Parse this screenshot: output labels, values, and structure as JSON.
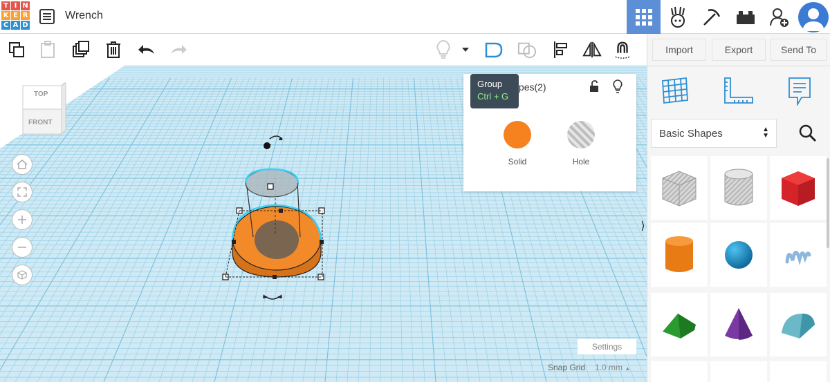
{
  "app": {
    "logo_letters": [
      "T",
      "I",
      "N",
      "K",
      "E",
      "R",
      "C",
      "A",
      "D"
    ],
    "logo_colors": [
      "#e2574c",
      "#e2574c",
      "#e2574c",
      "#f9a030",
      "#f9a030",
      "#f9a030",
      "#2f91cf",
      "#2f91cf",
      "#2f91cf"
    ],
    "title": "Wrench"
  },
  "header": {
    "icons": [
      "grid-view-icon",
      "tinker-figure-icon",
      "pickaxe-icon",
      "brick-icon",
      "add-user-icon",
      "avatar-icon"
    ],
    "active_icon": "grid-view-icon"
  },
  "toolbar": {
    "icons": [
      "copy-icon",
      "paste-icon",
      "duplicate-icon",
      "delete-icon",
      "undo-icon",
      "redo-icon",
      "lightbulb-icon",
      "dropdown-icon",
      "group-icon",
      "ungroup-icon",
      "align-icon",
      "mirror-icon",
      "magnet-icon"
    ],
    "import_label": "Import",
    "export_label": "Export",
    "send_to_label": "Send To"
  },
  "viewcube": {
    "top": "TOP",
    "front": "FRONT"
  },
  "tooltip": {
    "title": "Group",
    "shortcut": "Ctrl + G"
  },
  "inspector": {
    "title": "Shapes(2)",
    "solid_label": "Solid",
    "hole_label": "Hole",
    "solid_color": "#f5821f"
  },
  "workplane": {
    "settings_label": "Settings",
    "snap_label": "Snap Grid",
    "snap_value": "1.0 mm"
  },
  "shapes_panel": {
    "category": "Basic Shapes",
    "shapes": [
      "Box hole",
      "Cylinder hole",
      "Box",
      "Cylinder",
      "Sphere",
      "Scribble",
      "Roof",
      "Cone",
      "Round Roof"
    ]
  },
  "colors": {
    "accent": "#5d8fd6",
    "grid": "#a9d8ec",
    "orange": "#f5821f"
  }
}
